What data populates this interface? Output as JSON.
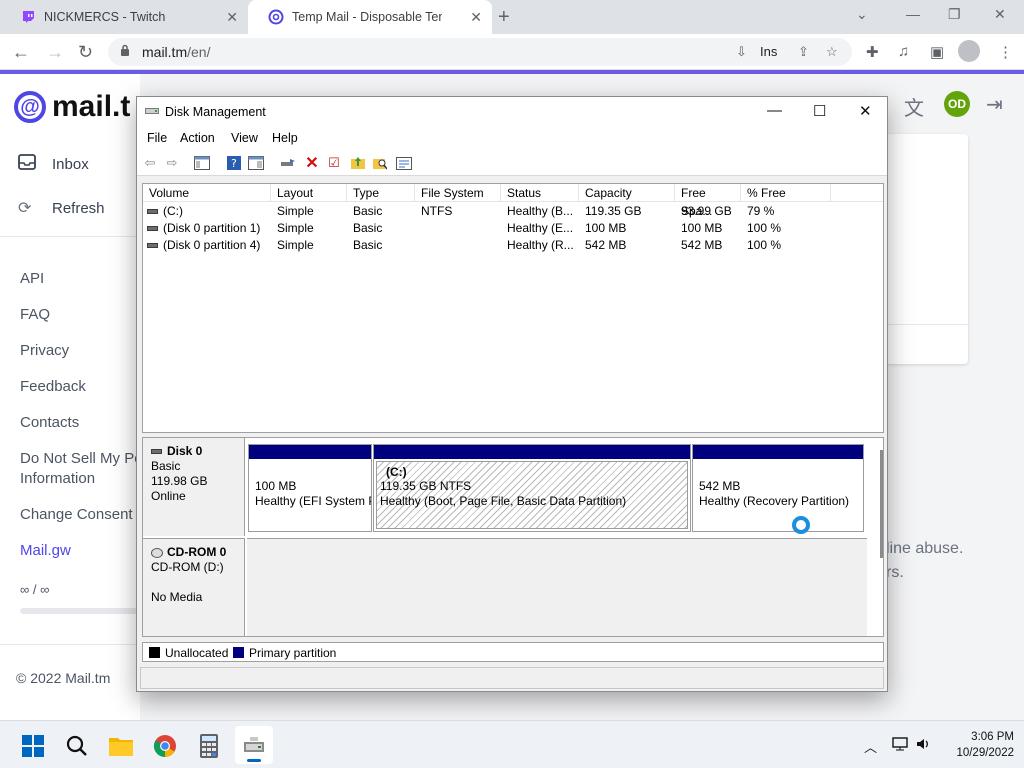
{
  "browser": {
    "tabs": [
      {
        "title": "NICKMERCS - Twitch",
        "favicon": "twitch-icon"
      },
      {
        "title": "Temp Mail - Disposable Tempora",
        "favicon": "mailtm-icon"
      }
    ],
    "url": "mail.tm/en/",
    "url_domain": "mail.tm",
    "url_path": "/en/",
    "ins_label": "Ins"
  },
  "page": {
    "logo_text": "mail.t",
    "nav": [
      {
        "label": "Inbox",
        "icon": "inbox-icon"
      },
      {
        "label": "Refresh",
        "icon": "refresh-icon"
      }
    ],
    "links": [
      "API",
      "FAQ",
      "Privacy",
      "Feedback",
      "Contacts",
      "Do Not Sell My Pe",
      "Information",
      "Change Consent",
      "Mail.gw"
    ],
    "counter": "∞  / ∞",
    "copyright": "© 2022 Mail.tm",
    "user_initials": "OD",
    "bg_text_1": "line abuse.",
    "bg_text_2": "rs."
  },
  "disk_management": {
    "title": "Disk Management",
    "menu": [
      "File",
      "Action",
      "View",
      "Help"
    ],
    "columns": [
      "Volume",
      "Layout",
      "Type",
      "File System",
      "Status",
      "Capacity",
      "Free Spa...",
      "% Free"
    ],
    "volumes": [
      {
        "volume": "(C:)",
        "layout": "Simple",
        "type": "Basic",
        "fs": "NTFS",
        "status": "Healthy (B...",
        "capacity": "119.35 GB",
        "free": "93.99 GB",
        "pct": "79 %"
      },
      {
        "volume": "(Disk 0 partition 1)",
        "layout": "Simple",
        "type": "Basic",
        "fs": "",
        "status": "Healthy (E...",
        "capacity": "100 MB",
        "free": "100 MB",
        "pct": "100 %"
      },
      {
        "volume": "(Disk 0 partition 4)",
        "layout": "Simple",
        "type": "Basic",
        "fs": "",
        "status": "Healthy (R...",
        "capacity": "542 MB",
        "free": "542 MB",
        "pct": "100 %"
      }
    ],
    "disk0": {
      "name": "Disk 0",
      "type": "Basic",
      "size": "119.98 GB",
      "state": "Online",
      "partitions": [
        {
          "name": "",
          "size": "100 MB",
          "status": "Healthy (EFI System P"
        },
        {
          "name": "(C:)",
          "size": "119.35 GB NTFS",
          "status": "Healthy (Boot, Page File, Basic Data Partition)"
        },
        {
          "name": "",
          "size": "542 MB",
          "status": "Healthy (Recovery Partition)"
        }
      ]
    },
    "cdrom": {
      "name": "CD-ROM 0",
      "drive": "CD-ROM (D:)",
      "media": "No Media"
    },
    "legend": [
      {
        "label": "Unallocated",
        "color": "#000000"
      },
      {
        "label": "Primary partition",
        "color": "#00007f"
      }
    ]
  },
  "taskbar": {
    "apps": [
      "start-icon",
      "search-icon",
      "file-explorer-icon",
      "chrome-icon",
      "calculator-icon",
      "disk-management-icon"
    ],
    "time": "3:06 PM",
    "date": "10/29/2022"
  },
  "colors": {
    "accent": "#6b5be6",
    "partition_header": "#00007f"
  }
}
